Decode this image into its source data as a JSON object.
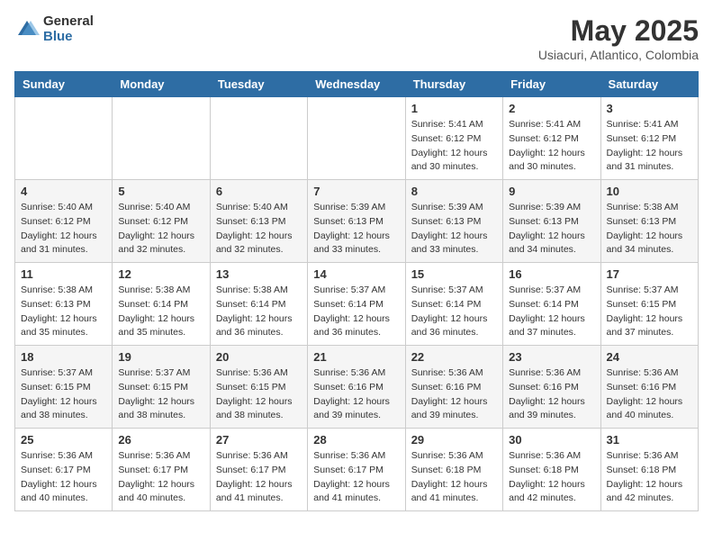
{
  "logo": {
    "general": "General",
    "blue": "Blue"
  },
  "title": {
    "month": "May 2025",
    "location": "Usiacuri, Atlantico, Colombia"
  },
  "weekdays": [
    "Sunday",
    "Monday",
    "Tuesday",
    "Wednesday",
    "Thursday",
    "Friday",
    "Saturday"
  ],
  "weeks": [
    [
      {
        "day": "",
        "info": ""
      },
      {
        "day": "",
        "info": ""
      },
      {
        "day": "",
        "info": ""
      },
      {
        "day": "",
        "info": ""
      },
      {
        "day": "1",
        "info": "Sunrise: 5:41 AM\nSunset: 6:12 PM\nDaylight: 12 hours\nand 30 minutes."
      },
      {
        "day": "2",
        "info": "Sunrise: 5:41 AM\nSunset: 6:12 PM\nDaylight: 12 hours\nand 30 minutes."
      },
      {
        "day": "3",
        "info": "Sunrise: 5:41 AM\nSunset: 6:12 PM\nDaylight: 12 hours\nand 31 minutes."
      }
    ],
    [
      {
        "day": "4",
        "info": "Sunrise: 5:40 AM\nSunset: 6:12 PM\nDaylight: 12 hours\nand 31 minutes."
      },
      {
        "day": "5",
        "info": "Sunrise: 5:40 AM\nSunset: 6:12 PM\nDaylight: 12 hours\nand 32 minutes."
      },
      {
        "day": "6",
        "info": "Sunrise: 5:40 AM\nSunset: 6:13 PM\nDaylight: 12 hours\nand 32 minutes."
      },
      {
        "day": "7",
        "info": "Sunrise: 5:39 AM\nSunset: 6:13 PM\nDaylight: 12 hours\nand 33 minutes."
      },
      {
        "day": "8",
        "info": "Sunrise: 5:39 AM\nSunset: 6:13 PM\nDaylight: 12 hours\nand 33 minutes."
      },
      {
        "day": "9",
        "info": "Sunrise: 5:39 AM\nSunset: 6:13 PM\nDaylight: 12 hours\nand 34 minutes."
      },
      {
        "day": "10",
        "info": "Sunrise: 5:38 AM\nSunset: 6:13 PM\nDaylight: 12 hours\nand 34 minutes."
      }
    ],
    [
      {
        "day": "11",
        "info": "Sunrise: 5:38 AM\nSunset: 6:13 PM\nDaylight: 12 hours\nand 35 minutes."
      },
      {
        "day": "12",
        "info": "Sunrise: 5:38 AM\nSunset: 6:14 PM\nDaylight: 12 hours\nand 35 minutes."
      },
      {
        "day": "13",
        "info": "Sunrise: 5:38 AM\nSunset: 6:14 PM\nDaylight: 12 hours\nand 36 minutes."
      },
      {
        "day": "14",
        "info": "Sunrise: 5:37 AM\nSunset: 6:14 PM\nDaylight: 12 hours\nand 36 minutes."
      },
      {
        "day": "15",
        "info": "Sunrise: 5:37 AM\nSunset: 6:14 PM\nDaylight: 12 hours\nand 36 minutes."
      },
      {
        "day": "16",
        "info": "Sunrise: 5:37 AM\nSunset: 6:14 PM\nDaylight: 12 hours\nand 37 minutes."
      },
      {
        "day": "17",
        "info": "Sunrise: 5:37 AM\nSunset: 6:15 PM\nDaylight: 12 hours\nand 37 minutes."
      }
    ],
    [
      {
        "day": "18",
        "info": "Sunrise: 5:37 AM\nSunset: 6:15 PM\nDaylight: 12 hours\nand 38 minutes."
      },
      {
        "day": "19",
        "info": "Sunrise: 5:37 AM\nSunset: 6:15 PM\nDaylight: 12 hours\nand 38 minutes."
      },
      {
        "day": "20",
        "info": "Sunrise: 5:36 AM\nSunset: 6:15 PM\nDaylight: 12 hours\nand 38 minutes."
      },
      {
        "day": "21",
        "info": "Sunrise: 5:36 AM\nSunset: 6:16 PM\nDaylight: 12 hours\nand 39 minutes."
      },
      {
        "day": "22",
        "info": "Sunrise: 5:36 AM\nSunset: 6:16 PM\nDaylight: 12 hours\nand 39 minutes."
      },
      {
        "day": "23",
        "info": "Sunrise: 5:36 AM\nSunset: 6:16 PM\nDaylight: 12 hours\nand 39 minutes."
      },
      {
        "day": "24",
        "info": "Sunrise: 5:36 AM\nSunset: 6:16 PM\nDaylight: 12 hours\nand 40 minutes."
      }
    ],
    [
      {
        "day": "25",
        "info": "Sunrise: 5:36 AM\nSunset: 6:17 PM\nDaylight: 12 hours\nand 40 minutes."
      },
      {
        "day": "26",
        "info": "Sunrise: 5:36 AM\nSunset: 6:17 PM\nDaylight: 12 hours\nand 40 minutes."
      },
      {
        "day": "27",
        "info": "Sunrise: 5:36 AM\nSunset: 6:17 PM\nDaylight: 12 hours\nand 41 minutes."
      },
      {
        "day": "28",
        "info": "Sunrise: 5:36 AM\nSunset: 6:17 PM\nDaylight: 12 hours\nand 41 minutes."
      },
      {
        "day": "29",
        "info": "Sunrise: 5:36 AM\nSunset: 6:18 PM\nDaylight: 12 hours\nand 41 minutes."
      },
      {
        "day": "30",
        "info": "Sunrise: 5:36 AM\nSunset: 6:18 PM\nDaylight: 12 hours\nand 42 minutes."
      },
      {
        "day": "31",
        "info": "Sunrise: 5:36 AM\nSunset: 6:18 PM\nDaylight: 12 hours\nand 42 minutes."
      }
    ]
  ]
}
